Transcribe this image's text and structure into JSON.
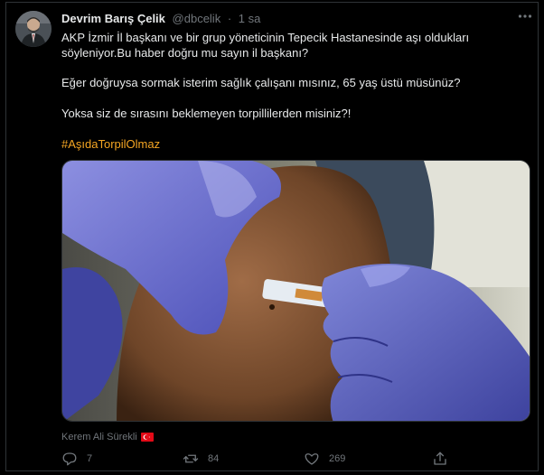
{
  "tweet": {
    "author_name": "Devrim Barış Çelik",
    "author_handle": "@dbcelik",
    "separator": "·",
    "time": "1 sa",
    "lines": [
      "AKP İzmir İl başkanı ve bir grup yöneticinin Tepecik Hastanesinde aşı oldukları",
      "söyleniyor.Bu haber doğru mu sayın il başkanı?",
      "Eğer doğruysa sormak isterim sağlık çalışanı mısınız, 65 yaş üstü müsünüz?",
      "Yoksa siz de sırasını beklemeyen torpillilerden misiniz?!"
    ],
    "hashtag": "#AşıdaTorpilOlmaz",
    "media_credit": "Kerem Ali Sürekli",
    "actions": {
      "reply_count": "7",
      "retweet_count": "84",
      "like_count": "269"
    }
  },
  "colors": {
    "background": "#000000",
    "text": "#e7e9ea",
    "muted": "#71767b",
    "hashtag": "#f5a623",
    "border": "#2f3336"
  },
  "icons": [
    "avatar",
    "more-icon",
    "turkey-flag-icon",
    "reply-icon",
    "retweet-icon",
    "like-icon",
    "share-icon"
  ]
}
